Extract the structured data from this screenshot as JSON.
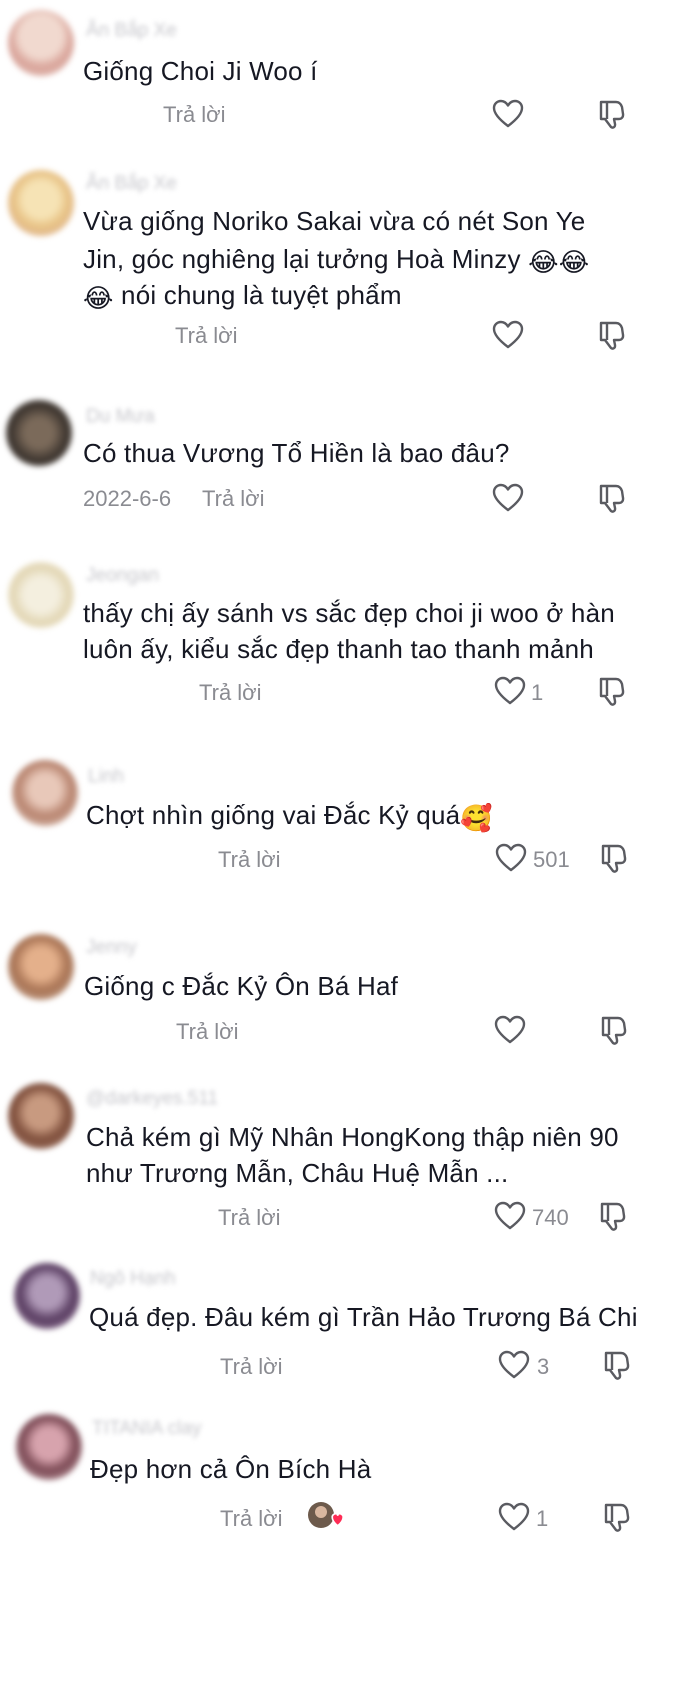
{
  "reply_label": "Trả lời",
  "comments": [
    {
      "user": "Ăn Bắp Xe",
      "text": "Giống Choi Ji Woo í",
      "date": "",
      "likes": ""
    },
    {
      "user": "Ăn Bắp Xe",
      "text_line1": "Vừa giống Noriko Sakai vừa có nét Son Ye",
      "text_line2": "Jin, góc nghiêng lại tưởng Hoà Minzy",
      "text_line3": "nói chung là tuyệt phẩm",
      "emoji": "😂",
      "date": "",
      "likes": ""
    },
    {
      "user": "Du Mưa",
      "text": "Có thua Vương Tổ Hiền là bao đâu?",
      "date": "2022-6-6",
      "likes": ""
    },
    {
      "user": "Jeongan",
      "text_line1": "thấy chị ấy sánh vs sắc đẹp choi ji woo ở hàn",
      "text_line2": "luôn ấy, kiểu sắc đẹp thanh tao thanh mảnh",
      "date": "",
      "likes": "1"
    },
    {
      "user": "Linh",
      "text": "Chợt nhìn giống vai Đắc Kỷ quá",
      "emoji": "🥰",
      "date": "",
      "likes": "501"
    },
    {
      "user": "Jenny",
      "text": "Giống c Đắc Kỷ Ôn Bá Haf",
      "date": "",
      "likes": ""
    },
    {
      "user": "@darkeyes.511",
      "text_line1": "Chả kém gì Mỹ Nhân HongKong thập niên 90",
      "text_line2": "như Trương Mẫn, Châu Huệ Mẫn ...",
      "date": "",
      "likes": "740"
    },
    {
      "user": "Ngô Hạnh",
      "text": "Quá đẹp. Đâu kém gì Trần Hảo Trương Bá Chi",
      "date": "",
      "likes": "3"
    },
    {
      "user": "TITANIA clay",
      "text": "Đẹp hơn cả Ôn Bích Hà",
      "date": "",
      "likes": "1"
    }
  ],
  "colors": {
    "text": "#161823",
    "meta": "#8a8b91",
    "icon_stroke": "#5a5b61",
    "background": "#ffffff"
  },
  "icons": {
    "like": "heart-outline-icon",
    "dislike": "thumbs-down-outline-icon",
    "reply_reaction": "creator-liked-avatar-icon"
  }
}
